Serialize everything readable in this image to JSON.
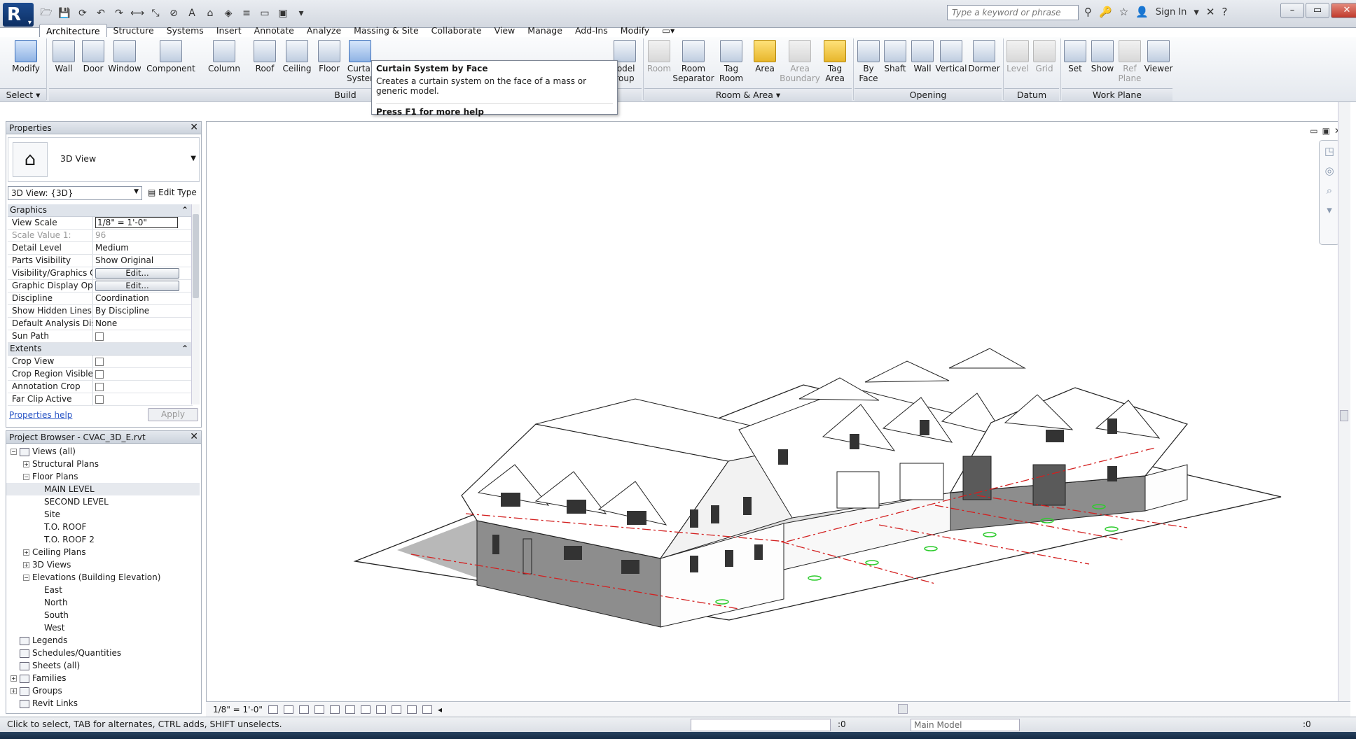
{
  "app": {
    "logo": "R",
    "search_placeholder": "Type a keyword or phrase",
    "sign_in": "Sign In"
  },
  "tabs": [
    "Architecture",
    "Structure",
    "Systems",
    "Insert",
    "Annotate",
    "Analyze",
    "Massing & Site",
    "Collaborate",
    "View",
    "Manage",
    "Add-Ins",
    "Modify"
  ],
  "ribbon": {
    "select": {
      "modify": "Modify",
      "panel": "Select ▾"
    },
    "build": {
      "wall": "Wall",
      "door": "Door",
      "window": "Window",
      "component": "Component",
      "column": "Column",
      "roof": "Roof",
      "ceiling": "Ceiling",
      "floor": "Floor",
      "curtain_system": "Curtai Syster",
      "model_group": "lodel roup",
      "panel": "Build"
    },
    "room_area": {
      "room": "Room",
      "room_separator": "Room Separator",
      "tag_room": "Tag Room",
      "area": "Area",
      "area_boundary": "Area Boundary",
      "tag_area": "Tag Area",
      "panel": "Room & Area ▾"
    },
    "opening": {
      "by_face": "By Face",
      "shaft": "Shaft",
      "wall": "Wall",
      "vertical": "Vertical",
      "dormer": "Dormer",
      "panel": "Opening"
    },
    "datum": {
      "level": "Level",
      "grid": "Grid",
      "panel": "Datum"
    },
    "work_plane": {
      "set": "Set",
      "show": "Show",
      "ref_plane": "Ref Plane",
      "viewer": "Viewer",
      "panel": "Work Plane"
    }
  },
  "tooltip": {
    "title": "Curtain System by Face",
    "body": "Creates a curtain system on the face of a mass or generic model.",
    "help": "Press F1 for more help"
  },
  "properties": {
    "title": "Properties",
    "type_name": "3D View",
    "instance": "3D View: {3D}",
    "edit_type": "Edit Type",
    "cat_graphics": "Graphics",
    "rows": [
      {
        "k": "View Scale",
        "v": "1/8\" = 1'-0\""
      },
      {
        "k": "Scale Value    1:",
        "v": "96"
      },
      {
        "k": "Detail Level",
        "v": "Medium"
      },
      {
        "k": "Parts Visibility",
        "v": "Show Original"
      },
      {
        "k": "Visibility/Graphics O...",
        "v": "Edit..."
      },
      {
        "k": "Graphic Display Opti...",
        "v": "Edit..."
      },
      {
        "k": "Discipline",
        "v": "Coordination"
      },
      {
        "k": "Show Hidden Lines",
        "v": "By Discipline"
      },
      {
        "k": "Default Analysis Dis...",
        "v": "None"
      },
      {
        "k": "Sun Path",
        "v": ""
      }
    ],
    "cat_extents": "Extents",
    "extents": [
      {
        "k": "Crop View"
      },
      {
        "k": "Crop Region Visible"
      },
      {
        "k": "Annotation Crop"
      },
      {
        "k": "Far Clip Active"
      }
    ],
    "help": "Properties help",
    "apply": "Apply"
  },
  "browser": {
    "title": "Project Browser - CVAC_3D_E.rvt",
    "nodes": [
      {
        "label": "Views (all)",
        "depth": 0,
        "exp": "−"
      },
      {
        "label": "Structural Plans",
        "depth": 1,
        "exp": "+"
      },
      {
        "label": "Floor Plans",
        "depth": 1,
        "exp": "−"
      },
      {
        "label": "MAIN LEVEL",
        "depth": 2,
        "exp": ""
      },
      {
        "label": "SECOND LEVEL",
        "depth": 2,
        "exp": ""
      },
      {
        "label": "Site",
        "depth": 2,
        "exp": ""
      },
      {
        "label": "T.O. ROOF",
        "depth": 2,
        "exp": ""
      },
      {
        "label": "T.O. ROOF 2",
        "depth": 2,
        "exp": ""
      },
      {
        "label": "Ceiling Plans",
        "depth": 1,
        "exp": "+"
      },
      {
        "label": "3D Views",
        "depth": 1,
        "exp": "+"
      },
      {
        "label": "Elevations (Building Elevation)",
        "depth": 1,
        "exp": "−"
      },
      {
        "label": "East",
        "depth": 2,
        "exp": ""
      },
      {
        "label": "North",
        "depth": 2,
        "exp": ""
      },
      {
        "label": "South",
        "depth": 2,
        "exp": ""
      },
      {
        "label": "West",
        "depth": 2,
        "exp": ""
      },
      {
        "label": "Legends",
        "depth": 0,
        "exp": ""
      },
      {
        "label": "Schedules/Quantities",
        "depth": 0,
        "exp": ""
      },
      {
        "label": "Sheets (all)",
        "depth": 0,
        "exp": ""
      },
      {
        "label": "Families",
        "depth": 0,
        "exp": "+"
      },
      {
        "label": "Groups",
        "depth": 0,
        "exp": "+"
      },
      {
        "label": "Revit Links",
        "depth": 0,
        "exp": ""
      }
    ]
  },
  "view_control": {
    "scale": "1/8\" = 1'-0\""
  },
  "status": {
    "message": "Click to select, TAB for alternates, CTRL adds, SHIFT unselects.",
    "count": ":0",
    "model": "Main Model",
    "filter_count": ":0"
  }
}
